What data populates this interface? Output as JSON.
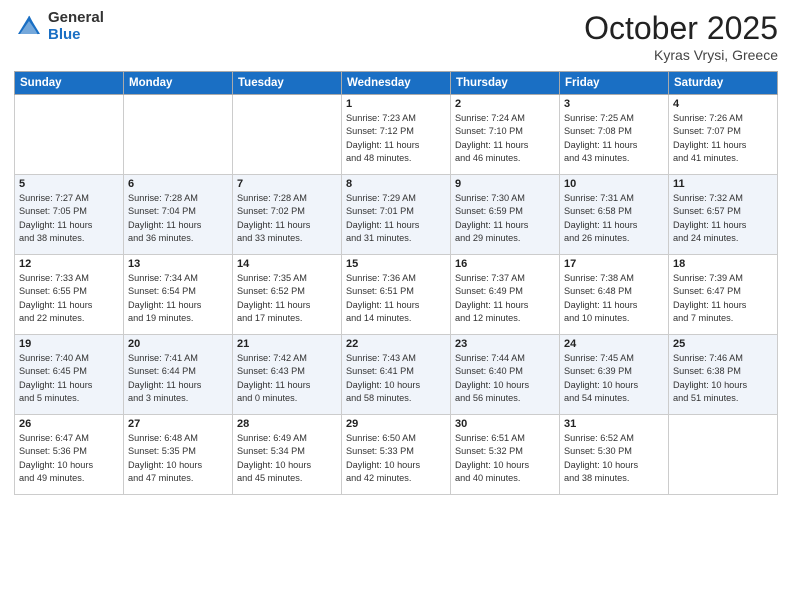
{
  "logo": {
    "general": "General",
    "blue": "Blue"
  },
  "header": {
    "month": "October 2025",
    "location": "Kyras Vrysi, Greece"
  },
  "weekdays": [
    "Sunday",
    "Monday",
    "Tuesday",
    "Wednesday",
    "Thursday",
    "Friday",
    "Saturday"
  ],
  "weeks": [
    [
      {
        "day": "",
        "info": ""
      },
      {
        "day": "",
        "info": ""
      },
      {
        "day": "",
        "info": ""
      },
      {
        "day": "1",
        "info": "Sunrise: 7:23 AM\nSunset: 7:12 PM\nDaylight: 11 hours\nand 48 minutes."
      },
      {
        "day": "2",
        "info": "Sunrise: 7:24 AM\nSunset: 7:10 PM\nDaylight: 11 hours\nand 46 minutes."
      },
      {
        "day": "3",
        "info": "Sunrise: 7:25 AM\nSunset: 7:08 PM\nDaylight: 11 hours\nand 43 minutes."
      },
      {
        "day": "4",
        "info": "Sunrise: 7:26 AM\nSunset: 7:07 PM\nDaylight: 11 hours\nand 41 minutes."
      }
    ],
    [
      {
        "day": "5",
        "info": "Sunrise: 7:27 AM\nSunset: 7:05 PM\nDaylight: 11 hours\nand 38 minutes."
      },
      {
        "day": "6",
        "info": "Sunrise: 7:28 AM\nSunset: 7:04 PM\nDaylight: 11 hours\nand 36 minutes."
      },
      {
        "day": "7",
        "info": "Sunrise: 7:28 AM\nSunset: 7:02 PM\nDaylight: 11 hours\nand 33 minutes."
      },
      {
        "day": "8",
        "info": "Sunrise: 7:29 AM\nSunset: 7:01 PM\nDaylight: 11 hours\nand 31 minutes."
      },
      {
        "day": "9",
        "info": "Sunrise: 7:30 AM\nSunset: 6:59 PM\nDaylight: 11 hours\nand 29 minutes."
      },
      {
        "day": "10",
        "info": "Sunrise: 7:31 AM\nSunset: 6:58 PM\nDaylight: 11 hours\nand 26 minutes."
      },
      {
        "day": "11",
        "info": "Sunrise: 7:32 AM\nSunset: 6:57 PM\nDaylight: 11 hours\nand 24 minutes."
      }
    ],
    [
      {
        "day": "12",
        "info": "Sunrise: 7:33 AM\nSunset: 6:55 PM\nDaylight: 11 hours\nand 22 minutes."
      },
      {
        "day": "13",
        "info": "Sunrise: 7:34 AM\nSunset: 6:54 PM\nDaylight: 11 hours\nand 19 minutes."
      },
      {
        "day": "14",
        "info": "Sunrise: 7:35 AM\nSunset: 6:52 PM\nDaylight: 11 hours\nand 17 minutes."
      },
      {
        "day": "15",
        "info": "Sunrise: 7:36 AM\nSunset: 6:51 PM\nDaylight: 11 hours\nand 14 minutes."
      },
      {
        "day": "16",
        "info": "Sunrise: 7:37 AM\nSunset: 6:49 PM\nDaylight: 11 hours\nand 12 minutes."
      },
      {
        "day": "17",
        "info": "Sunrise: 7:38 AM\nSunset: 6:48 PM\nDaylight: 11 hours\nand 10 minutes."
      },
      {
        "day": "18",
        "info": "Sunrise: 7:39 AM\nSunset: 6:47 PM\nDaylight: 11 hours\nand 7 minutes."
      }
    ],
    [
      {
        "day": "19",
        "info": "Sunrise: 7:40 AM\nSunset: 6:45 PM\nDaylight: 11 hours\nand 5 minutes."
      },
      {
        "day": "20",
        "info": "Sunrise: 7:41 AM\nSunset: 6:44 PM\nDaylight: 11 hours\nand 3 minutes."
      },
      {
        "day": "21",
        "info": "Sunrise: 7:42 AM\nSunset: 6:43 PM\nDaylight: 11 hours\nand 0 minutes."
      },
      {
        "day": "22",
        "info": "Sunrise: 7:43 AM\nSunset: 6:41 PM\nDaylight: 10 hours\nand 58 minutes."
      },
      {
        "day": "23",
        "info": "Sunrise: 7:44 AM\nSunset: 6:40 PM\nDaylight: 10 hours\nand 56 minutes."
      },
      {
        "day": "24",
        "info": "Sunrise: 7:45 AM\nSunset: 6:39 PM\nDaylight: 10 hours\nand 54 minutes."
      },
      {
        "day": "25",
        "info": "Sunrise: 7:46 AM\nSunset: 6:38 PM\nDaylight: 10 hours\nand 51 minutes."
      }
    ],
    [
      {
        "day": "26",
        "info": "Sunrise: 6:47 AM\nSunset: 5:36 PM\nDaylight: 10 hours\nand 49 minutes."
      },
      {
        "day": "27",
        "info": "Sunrise: 6:48 AM\nSunset: 5:35 PM\nDaylight: 10 hours\nand 47 minutes."
      },
      {
        "day": "28",
        "info": "Sunrise: 6:49 AM\nSunset: 5:34 PM\nDaylight: 10 hours\nand 45 minutes."
      },
      {
        "day": "29",
        "info": "Sunrise: 6:50 AM\nSunset: 5:33 PM\nDaylight: 10 hours\nand 42 minutes."
      },
      {
        "day": "30",
        "info": "Sunrise: 6:51 AM\nSunset: 5:32 PM\nDaylight: 10 hours\nand 40 minutes."
      },
      {
        "day": "31",
        "info": "Sunrise: 6:52 AM\nSunset: 5:30 PM\nDaylight: 10 hours\nand 38 minutes."
      },
      {
        "day": "",
        "info": ""
      }
    ]
  ]
}
